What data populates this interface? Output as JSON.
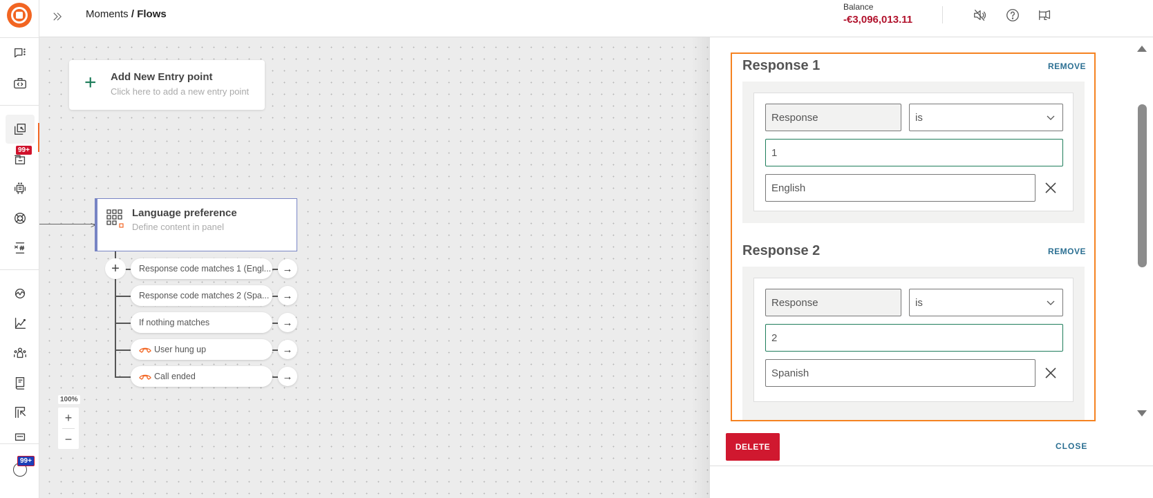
{
  "header": {
    "breadcrumb_parent": "Moments",
    "breadcrumb_sep": " / ",
    "breadcrumb_current": "Flows",
    "balance_label": "Balance",
    "balance_value": "-€3,096,013.11",
    "icons": [
      "mute-icon",
      "help-icon",
      "announcement-icon"
    ]
  },
  "sidebar": {
    "items": [
      {
        "name": "conversations",
        "icon": "chat-icon"
      },
      {
        "name": "developer-tools",
        "icon": "code-briefcase-icon"
      },
      {
        "name": "moments",
        "icon": "moments-icon",
        "active": true
      },
      {
        "name": "inbox",
        "icon": "inbox-icon",
        "badge": "99+"
      },
      {
        "name": "chatbots",
        "icon": "robot-icon"
      },
      {
        "name": "ai",
        "icon": "ai-icon"
      },
      {
        "name": "numbers",
        "icon": "hashtag-icon"
      },
      {
        "name": "integrations",
        "icon": "pulse-icon"
      },
      {
        "name": "analytics",
        "icon": "chart-icon"
      },
      {
        "name": "people",
        "icon": "people-icon"
      },
      {
        "name": "documentation",
        "icon": "book-icon"
      },
      {
        "name": "exports",
        "icon": "export-icon"
      },
      {
        "name": "more",
        "icon": "more-icon"
      }
    ],
    "bottom_badge": "99+",
    "accent_color": "#f26522"
  },
  "canvas": {
    "entry_point": {
      "title": "Add New Entry point",
      "subtitle": "Click here to add a new entry point"
    },
    "node": {
      "title": "Language preference",
      "subtitle": "Define content in panel"
    },
    "branches": [
      {
        "label": "Response code matches 1 (Engl...",
        "icon": null
      },
      {
        "label": "Response code matches 2 (Spa...",
        "icon": null
      },
      {
        "label": "If nothing matches",
        "icon": null
      },
      {
        "label": "User hung up",
        "icon": "hangup-icon"
      },
      {
        "label": "Call ended",
        "icon": "hangup-icon"
      }
    ],
    "add_branch": "+",
    "go_arrow": "→",
    "zoom_level": "100%",
    "zoom_in": "+",
    "zoom_out": "−"
  },
  "panel": {
    "responses": [
      {
        "title": "Response 1",
        "remove_label": "REMOVE",
        "field": "Response",
        "operator": "is",
        "value": "1",
        "label_value": "English"
      },
      {
        "title": "Response 2",
        "remove_label": "REMOVE",
        "field": "Response",
        "operator": "is",
        "value": "2",
        "label_value": "Spanish"
      }
    ],
    "delete_label": "DELETE",
    "close_label": "CLOSE",
    "highlight_color": "#f58220",
    "delete_color": "#d0182f",
    "link_color": "#2b6f92"
  }
}
